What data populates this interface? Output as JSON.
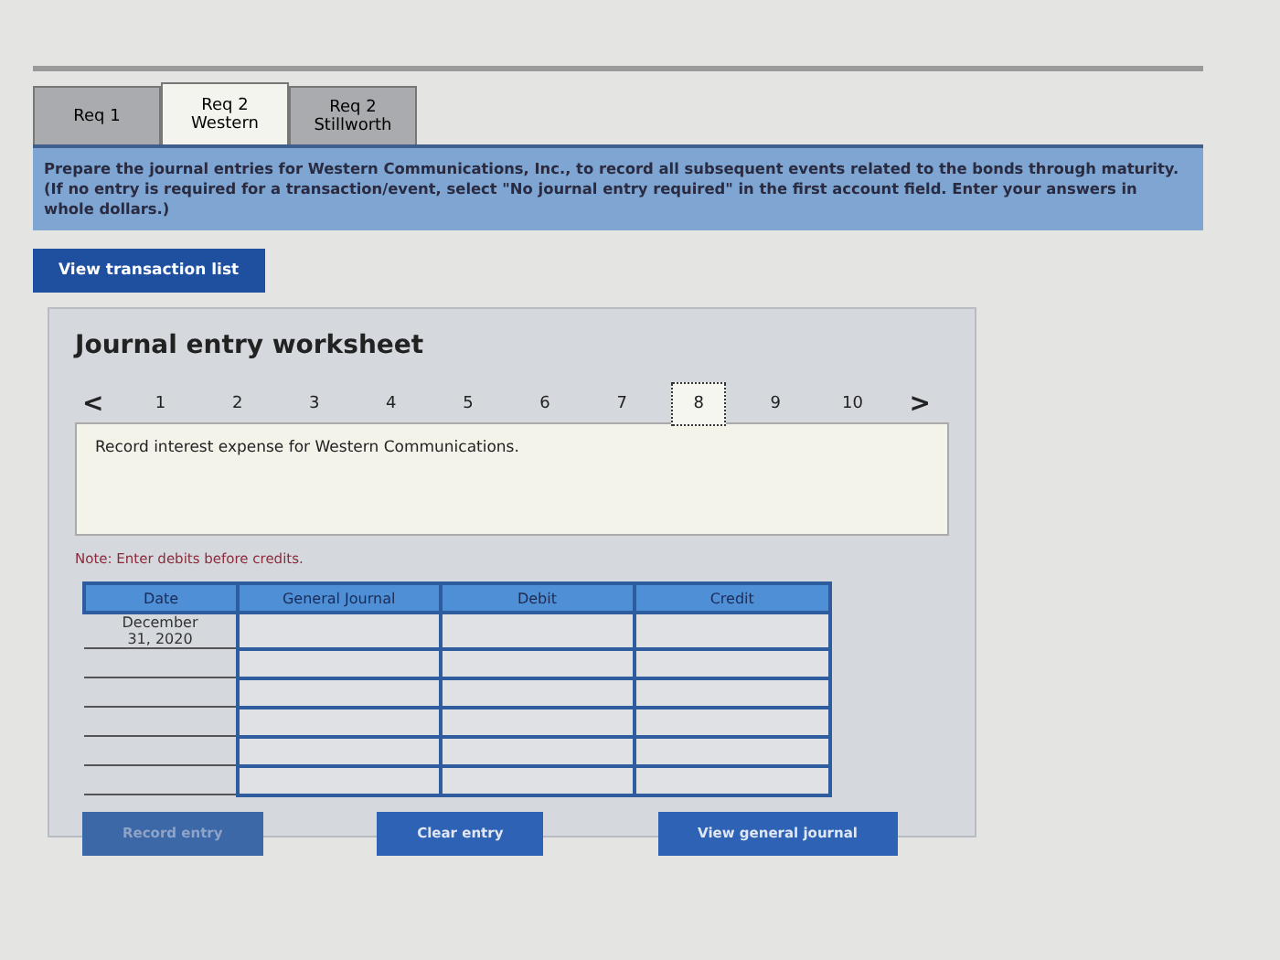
{
  "tabs": [
    {
      "label": "Req 1",
      "selected": false
    },
    {
      "label": "Req 2 Western",
      "selected": true
    },
    {
      "label": "Req 2 Stillworth",
      "selected": false
    }
  ],
  "instructions": "Prepare the journal entries for Western Communications, Inc., to record all subsequent events related to the bonds through maturity. (If no entry is required for a transaction/event, select \"No journal entry required\" in the first account field. Enter your answers in whole dollars.)",
  "transaction_button": "View transaction list",
  "worksheet": {
    "title": "Journal entry worksheet",
    "prev": "<",
    "next": ">",
    "pages": [
      {
        "label": "1",
        "selected": false
      },
      {
        "label": "2",
        "selected": false
      },
      {
        "label": "3",
        "selected": false
      },
      {
        "label": "4",
        "selected": false
      },
      {
        "label": "5",
        "selected": false
      },
      {
        "label": "6",
        "selected": false
      },
      {
        "label": "7",
        "selected": false
      },
      {
        "label": "8",
        "selected": true
      },
      {
        "label": "9",
        "selected": false
      },
      {
        "label": "10",
        "selected": false
      }
    ],
    "description": "Record interest expense for Western Communications.",
    "note": "Note: Enter debits before credits.",
    "table": {
      "columns": [
        "Date",
        "General Journal",
        "Debit",
        "Credit"
      ],
      "rows": [
        {
          "date": "December 31, 2020"
        },
        {},
        {},
        {},
        {},
        {}
      ]
    },
    "buttons": [
      {
        "label": "Record entry",
        "disabled": true
      },
      {
        "label": "Clear entry",
        "disabled": false
      },
      {
        "label": "View general journal",
        "disabled": false
      }
    ]
  }
}
